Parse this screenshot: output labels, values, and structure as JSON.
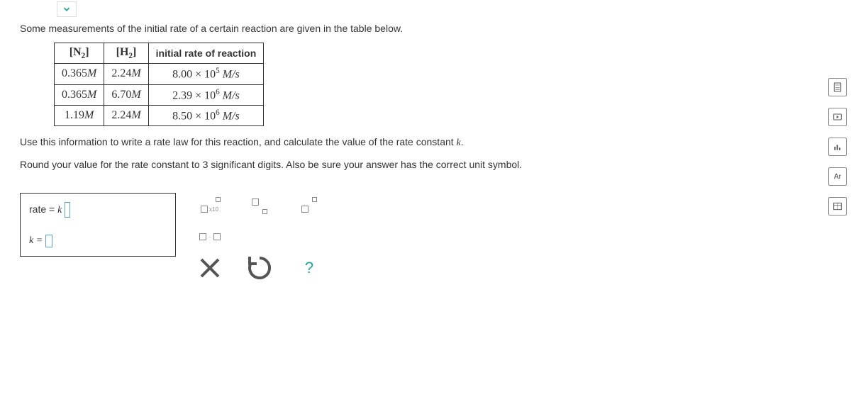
{
  "intro": "Some measurements of the initial rate of a certain reaction are given in the table below.",
  "table": {
    "headers": {
      "c1": "N",
      "c1sub": "2",
      "c2": "H",
      "c2sub": "2",
      "c3": "initial rate of reaction"
    },
    "rows": [
      {
        "n2": "0.365",
        "n2u": "M",
        "h2": "2.24",
        "h2u": "M",
        "rate_m": "8.00",
        "rate_e": "5",
        "rate_u": "M/s"
      },
      {
        "n2": "0.365",
        "n2u": "M",
        "h2": "6.70",
        "h2u": "M",
        "rate_m": "2.39",
        "rate_e": "6",
        "rate_u": "M/s"
      },
      {
        "n2": "1.19",
        "n2u": "M",
        "h2": "2.24",
        "h2u": "M",
        "rate_m": "8.50",
        "rate_e": "6",
        "rate_u": "M/s"
      }
    ]
  },
  "instr1_a": "Use this information to write a rate law for this reaction, and calculate the value of the rate constant ",
  "instr1_k": "k",
  "instr1_b": ".",
  "instr2": "Round your value for the rate constant to 3 significant digits. Also be sure your answer has the correct unit symbol.",
  "answer": {
    "rate_label_a": "rate = ",
    "rate_label_k": "k",
    "k_label": "k = "
  },
  "palette": {
    "x10_sub": "x10",
    "help": "?"
  },
  "toolbar": {
    "ar": "Ar"
  }
}
